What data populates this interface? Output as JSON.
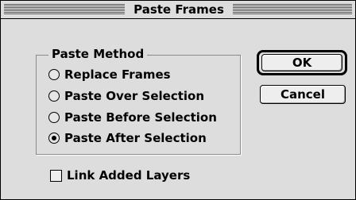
{
  "window": {
    "title": "Paste Frames"
  },
  "group": {
    "label": "Paste Method",
    "options": [
      {
        "label": "Replace Frames",
        "selected": false
      },
      {
        "label": "Paste Over Selection",
        "selected": false
      },
      {
        "label": "Paste Before Selection",
        "selected": false
      },
      {
        "label": "Paste After Selection",
        "selected": true
      }
    ]
  },
  "buttons": {
    "ok": "OK",
    "cancel": "Cancel"
  },
  "checkbox": {
    "label": "Link Added Layers",
    "checked": false
  }
}
